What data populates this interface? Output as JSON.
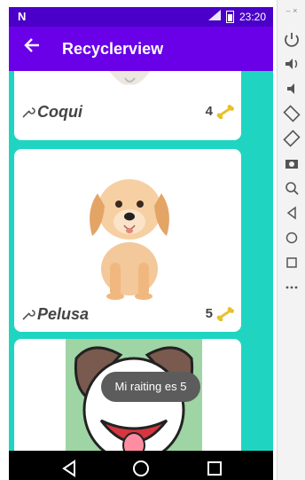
{
  "status": {
    "left_icon": "N",
    "signal_label": "LTE",
    "time": "23:20"
  },
  "appbar": {
    "title": "Recyclerview",
    "back_icon": "arrow-left-icon"
  },
  "items": [
    {
      "name": "Coqui",
      "rating": "4"
    },
    {
      "name": "Pelusa",
      "rating": "5"
    },
    {
      "name": "",
      "rating": ""
    }
  ],
  "toast": {
    "text": "Mi raiting es 5"
  },
  "colors": {
    "status": "#4a00c8",
    "appbar": "#6a00e8",
    "list_bg": "#1fd5c2",
    "bone": "#e8c02a"
  },
  "side_toolbar": {
    "icons": [
      "power-icon",
      "volume-up-icon",
      "volume-down-icon",
      "rotate-left-icon",
      "rotate-right-icon",
      "camera-icon",
      "zoom-icon",
      "back-icon",
      "home-icon",
      "overview-icon",
      "more-icon"
    ]
  }
}
